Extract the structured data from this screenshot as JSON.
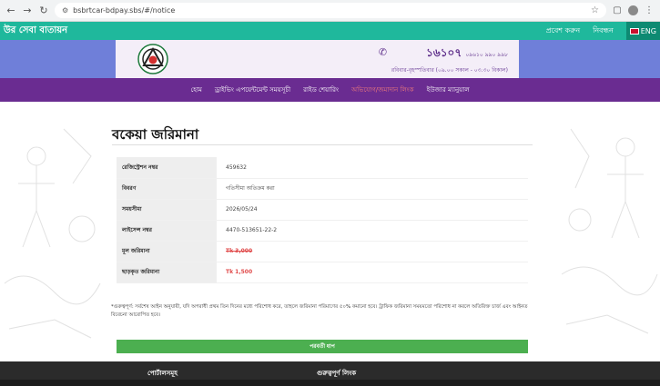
{
  "browser": {
    "url": "bsbrtcar-bdpay.sbs/#/notice"
  },
  "topbar": {
    "title": "উর সেবা বাতায়ন",
    "login": "প্রবেশ করুন",
    "register": "নিবন্ধন",
    "lang": "ENG"
  },
  "header": {
    "hotline": "১৬১০৭",
    "hotline_alt": "০৯৬১০ ৯৯০ ৯৯৮",
    "hours": "রবিবার-বৃহস্পতিবার (০৯.০০ সকাল - ০৩.৩০ বিকাল)"
  },
  "nav": [
    {
      "label": "হোম",
      "active": false
    },
    {
      "label": "ড্রাইভিং এপয়েন্টমেন্ট সময়সূচী",
      "active": false
    },
    {
      "label": "রাইড শেয়ারিং",
      "active": false
    },
    {
      "label": "অভিযোগ/জমাদান লিংক",
      "active": true
    },
    {
      "label": "ইউজার ম্যানুয়াল",
      "active": false
    }
  ],
  "page": {
    "title": "বকেয়া জরিমানা",
    "rows": [
      {
        "label": "রেজিস্ট্রেশন নম্বর",
        "value": "459632"
      },
      {
        "label": "বিবরণ",
        "value": "গতিসীমা অতিক্রম করা"
      },
      {
        "label": "সময়সীমা",
        "value": "2026/05/24"
      },
      {
        "label": "লাইসেন্স নম্বর",
        "value": "4470-513651-22-2"
      },
      {
        "label": "মূল জরিমানা",
        "value": "Tk 3,000"
      },
      {
        "label": "ছাড়কৃত জরিমানা",
        "value": "Tk 1,500"
      }
    ],
    "note": "*গুরুত্বপূর্ণ: সর্বশেষ আইন অনুযায়ী, যদি অপরাধী প্রথম তিন দিনের মধ্যে পরিশোধ করে, তাহলে জরিমানা পরিমাণের ৫০% কমানো হবে। ট্রাফিক জরিমানা সময়মতো পরিশোধ না করলে অতিরিক্ত চার্জ এবং আইনত বিবেচনা আরোপিত হবে।",
    "next_button": "পরবর্তী ধাপ"
  },
  "footer": {
    "col1": "পোর্টালসমূহ",
    "col2": "গুরুত্বপূর্ণ লিংক"
  },
  "colors": {
    "green": "#1fb89c",
    "purple": "#6a2c91",
    "header_blue": "#6f7fd9",
    "button_green": "#4caf50",
    "fine_red": "#e04a4a"
  }
}
